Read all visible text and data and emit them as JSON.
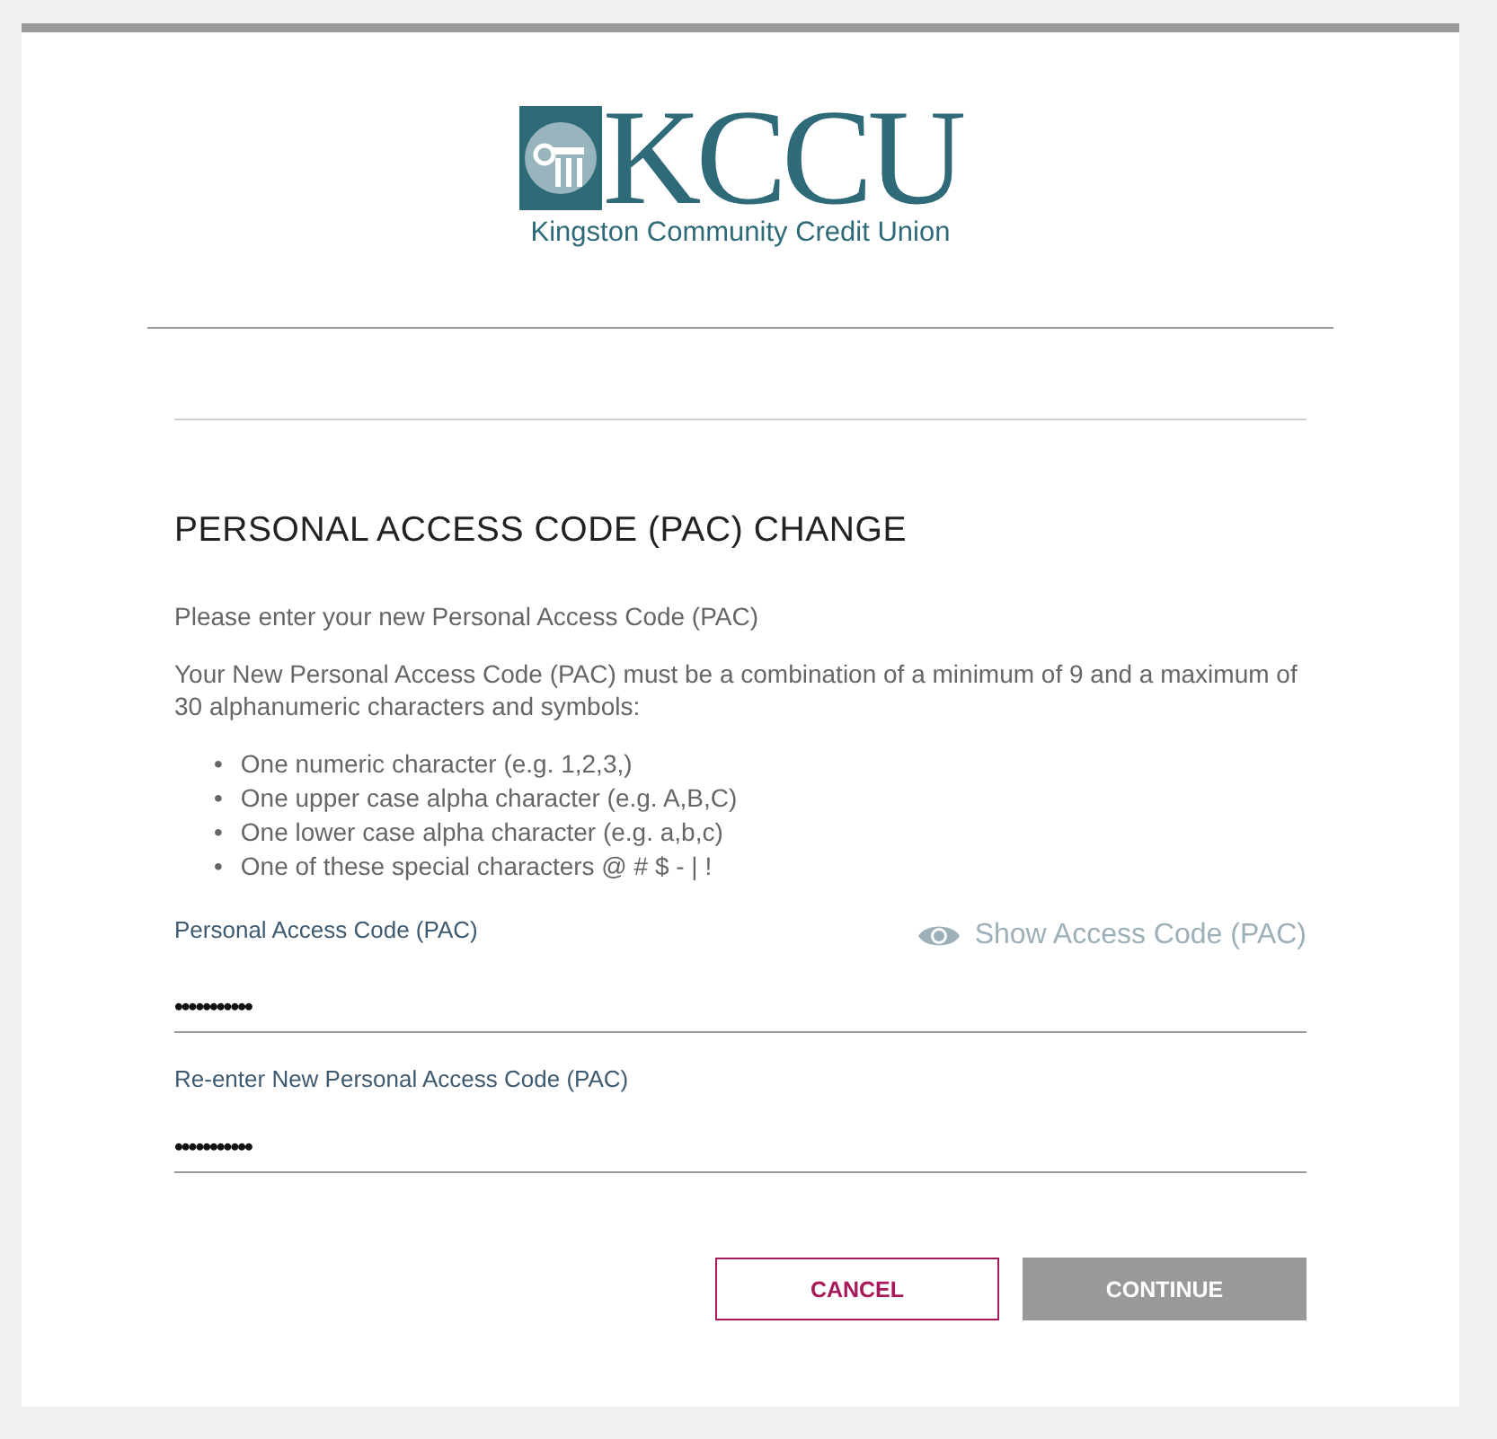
{
  "logo": {
    "wordmark": "KCCU",
    "tagline": "Kingston Community Credit Union"
  },
  "form": {
    "title": "PERSONAL ACCESS CODE (PAC) CHANGE",
    "intro": "Please enter your new Personal Access Code (PAC)",
    "requirements": "Your New Personal Access Code (PAC) must be a combination of a minimum of 9 and a maximum of 30 alphanumeric characters and symbols:",
    "rules": [
      {
        "bullet": "•",
        "text": "One numeric character (e.g. 1,2,3,)"
      },
      {
        "bullet": "•",
        "text": "One upper case alpha character (e.g. A,B,C)"
      },
      {
        "bullet": "•",
        "text": "One lower case alpha character (e.g. a,b,c)"
      },
      {
        "bullet": "•",
        "text": "One of these special characters @ # $ - | !"
      }
    ],
    "show_toggle": "Show Access Code (PAC)",
    "fields": [
      {
        "label": "Personal Access Code (PAC)",
        "value": "•••••••••••",
        "show_toggle": true
      },
      {
        "label": "Re-enter New Personal Access Code (PAC)",
        "value": "•••••••••••"
      }
    ],
    "buttons": [
      {
        "label": "CANCEL",
        "kind": "outline",
        "disabled": false
      },
      {
        "label": "CONTINUE",
        "kind": "primary",
        "disabled": true
      }
    ]
  }
}
